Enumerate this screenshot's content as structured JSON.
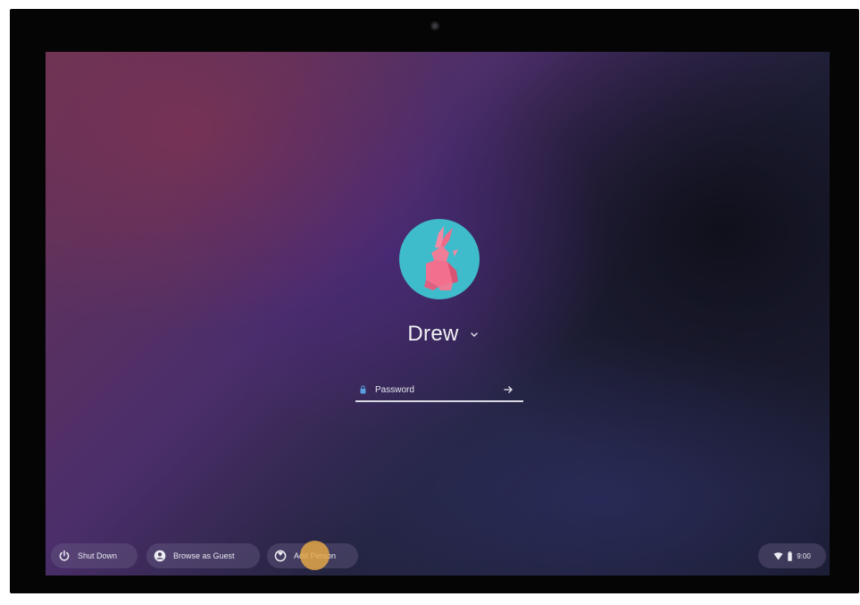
{
  "user": {
    "name": "Drew"
  },
  "password_field": {
    "placeholder": "Password",
    "value": ""
  },
  "shelf": {
    "shut_down_label": "Shut Down",
    "browse_guest_label": "Browse as Guest",
    "add_person_label": "Add Person"
  },
  "status_tray": {
    "time": "9:00"
  },
  "colors": {
    "avatar_bg": "#3fbccb",
    "touch_indicator": "#e6aa46"
  },
  "icons": {
    "power": "power-icon",
    "guest": "account-circle-icon",
    "add_person": "add-person-icon",
    "lock": "lock-icon",
    "submit": "arrow-right-icon",
    "wifi": "wifi-icon",
    "battery": "battery-icon",
    "chevron": "chevron-down-icon"
  }
}
